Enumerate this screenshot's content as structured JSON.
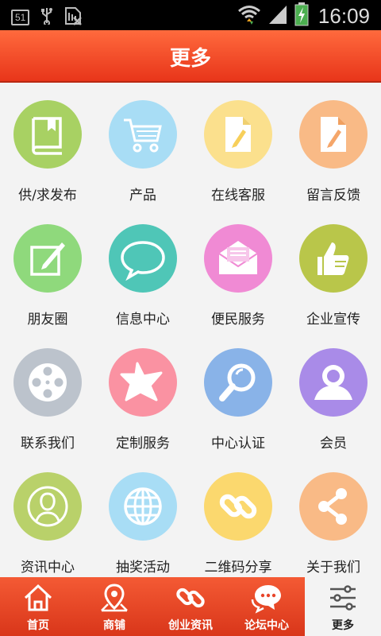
{
  "status_bar": {
    "badge": "51",
    "time": "16:09",
    "icons": [
      "usb-icon",
      "sim-icon",
      "wifi-icon",
      "signal-icon",
      "battery-charging-icon"
    ]
  },
  "header": {
    "title": "更多"
  },
  "grid": {
    "items": [
      {
        "label": "供/求发布",
        "icon": "book-icon",
        "color": "#a8d163"
      },
      {
        "label": "产品",
        "icon": "cart-icon",
        "color": "#a8ddf5"
      },
      {
        "label": "在线客服",
        "icon": "document-edit-icon",
        "color": "#fbe08d"
      },
      {
        "label": "留言反馈",
        "icon": "document-edit-icon",
        "color": "#f9ba86"
      },
      {
        "label": "朋友圈",
        "icon": "note-edit-icon",
        "color": "#8fd97c"
      },
      {
        "label": "信息中心",
        "icon": "chat-bubble-icon",
        "color": "#4fc6b7"
      },
      {
        "label": "便民服务",
        "icon": "mail-icon",
        "color": "#f08ad4"
      },
      {
        "label": "企业宣传",
        "icon": "thumbs-up-icon",
        "color": "#b9c64a"
      },
      {
        "label": "联系我们",
        "icon": "film-reel-icon",
        "color": "#bcc3cc"
      },
      {
        "label": "定制服务",
        "icon": "star-icon",
        "color": "#fa92a2"
      },
      {
        "label": "中心认证",
        "icon": "magnifier-icon",
        "color": "#89b3e8"
      },
      {
        "label": "会员",
        "icon": "user-icon",
        "color": "#a98be8"
      },
      {
        "label": "资讯中心",
        "icon": "person-icon",
        "color": "#b9d16a"
      },
      {
        "label": "抽奖活动",
        "icon": "globe-icon",
        "color": "#a8ddf5"
      },
      {
        "label": "二维码分享",
        "icon": "link-icon",
        "color": "#fbd86e"
      },
      {
        "label": "关于我们",
        "icon": "share-icon",
        "color": "#f9ba86"
      }
    ]
  },
  "nav": {
    "items": [
      {
        "label": "首页",
        "icon": "home-icon"
      },
      {
        "label": "商铺",
        "icon": "map-pin-icon"
      },
      {
        "label": "创业资讯",
        "icon": "link-icon"
      },
      {
        "label": "论坛中心",
        "icon": "chat-icon"
      },
      {
        "label": "更多",
        "icon": "settings-sliders-icon",
        "active": true
      }
    ]
  }
}
